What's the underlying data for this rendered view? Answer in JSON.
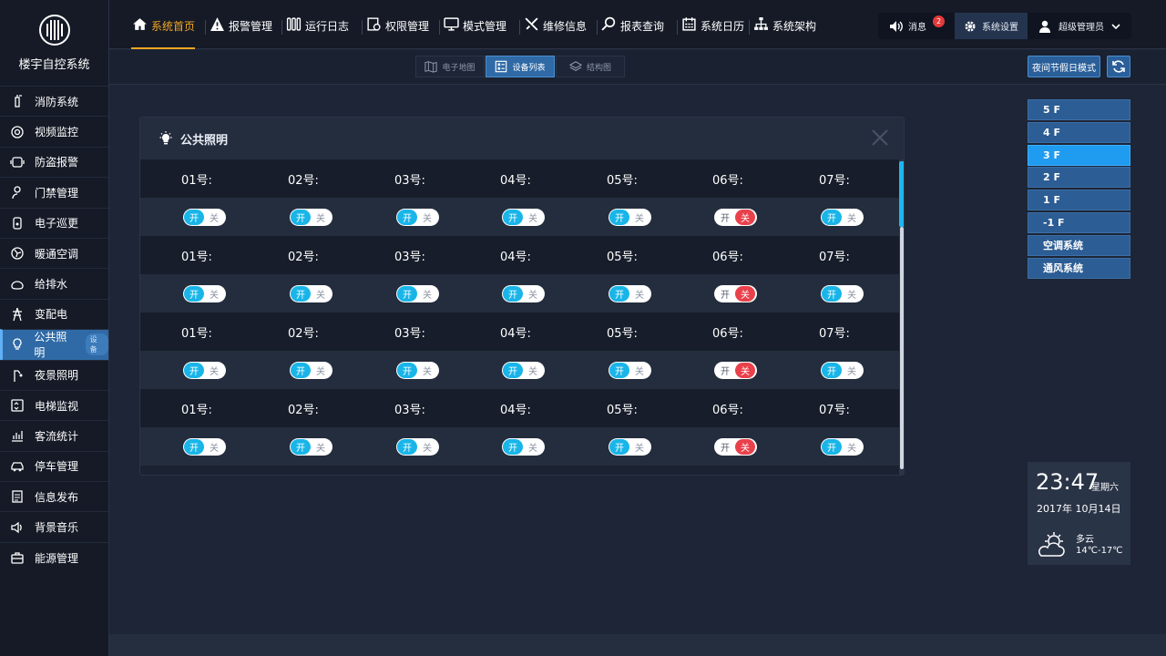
{
  "app": {
    "title": "楼宇自控系统"
  },
  "sidebar": {
    "items": [
      {
        "label": "消防系统",
        "icon": "fire-extinguisher-icon"
      },
      {
        "label": "视频监控",
        "icon": "camera-icon"
      },
      {
        "label": "防盗报警",
        "icon": "alarm-icon"
      },
      {
        "label": "门禁管理",
        "icon": "door-access-icon"
      },
      {
        "label": "电子巡更",
        "icon": "patrol-icon"
      },
      {
        "label": "暖通空调",
        "icon": "fan-icon"
      },
      {
        "label": "给排水",
        "icon": "water-icon"
      },
      {
        "label": "变配电",
        "icon": "power-tower-icon"
      },
      {
        "label": "公共照明",
        "icon": "bulb-icon",
        "badge": "设备"
      },
      {
        "label": "夜景照明",
        "icon": "street-lamp-icon"
      },
      {
        "label": "电梯监视",
        "icon": "elevator-icon"
      },
      {
        "label": "客流统计",
        "icon": "chart-icon"
      },
      {
        "label": "停车管理",
        "icon": "car-icon"
      },
      {
        "label": "信息发布",
        "icon": "document-icon"
      },
      {
        "label": "背景音乐",
        "icon": "speaker-icon"
      },
      {
        "label": "能源管理",
        "icon": "briefcase-icon"
      }
    ]
  },
  "topnav": {
    "items": [
      {
        "label": "系统首页",
        "icon": "home-icon"
      },
      {
        "label": "报警管理",
        "icon": "warning-icon"
      },
      {
        "label": "运行日志",
        "icon": "log-icon"
      },
      {
        "label": "权限管理",
        "icon": "permission-icon"
      },
      {
        "label": "模式管理",
        "icon": "monitor-icon"
      },
      {
        "label": "维修信息",
        "icon": "tools-icon"
      },
      {
        "label": "报表查询",
        "icon": "search-icon"
      },
      {
        "label": "系统日历",
        "icon": "calendar-icon"
      },
      {
        "label": "系统架构",
        "icon": "hierarchy-icon"
      }
    ],
    "messages_label": "消息",
    "messages_count": "2",
    "settings_label": "系统设置",
    "user_label": "超级管理员"
  },
  "subnav": {
    "tabs": [
      {
        "label": "电子地图",
        "icon": "map-icon"
      },
      {
        "label": "设备列表",
        "icon": "list-icon"
      },
      {
        "label": "结构图",
        "icon": "layers-icon"
      }
    ],
    "holiday_label": "夜间节假日模式"
  },
  "panel": {
    "title": "公共照明",
    "on_label": "开",
    "off_label": "关",
    "rows": [
      {
        "labels": [
          "01号:",
          "02号:",
          "03号:",
          "04号:",
          "05号:",
          "06号:",
          "07号:"
        ],
        "states": [
          "on",
          "on",
          "on",
          "on",
          "on",
          "off",
          "on"
        ]
      },
      {
        "labels": [
          "01号:",
          "02号:",
          "03号:",
          "04号:",
          "05号:",
          "06号:",
          "07号:"
        ],
        "states": [
          "on",
          "on",
          "on",
          "on",
          "on",
          "off",
          "on"
        ]
      },
      {
        "labels": [
          "01号:",
          "02号:",
          "03号:",
          "04号:",
          "05号:",
          "06号:",
          "07号:"
        ],
        "states": [
          "on",
          "on",
          "on",
          "on",
          "on",
          "off",
          "on"
        ]
      },
      {
        "labels": [
          "01号:",
          "02号:",
          "03号:",
          "04号:",
          "05号:",
          "06号:",
          "07号:"
        ],
        "states": [
          "on",
          "on",
          "on",
          "on",
          "on",
          "off",
          "on"
        ]
      }
    ]
  },
  "floors": {
    "items": [
      "5 F",
      "4 F",
      "3 F",
      "2 F",
      "1 F",
      "-1 F",
      "空调系统",
      "通风系统"
    ],
    "selected": "3 F"
  },
  "weather": {
    "time": "23:47",
    "weekday": "星期六",
    "date": "2017年 10月14日",
    "condition": "多云",
    "temperature": "14℃-17℃",
    "icon": "cloudy-icon"
  }
}
